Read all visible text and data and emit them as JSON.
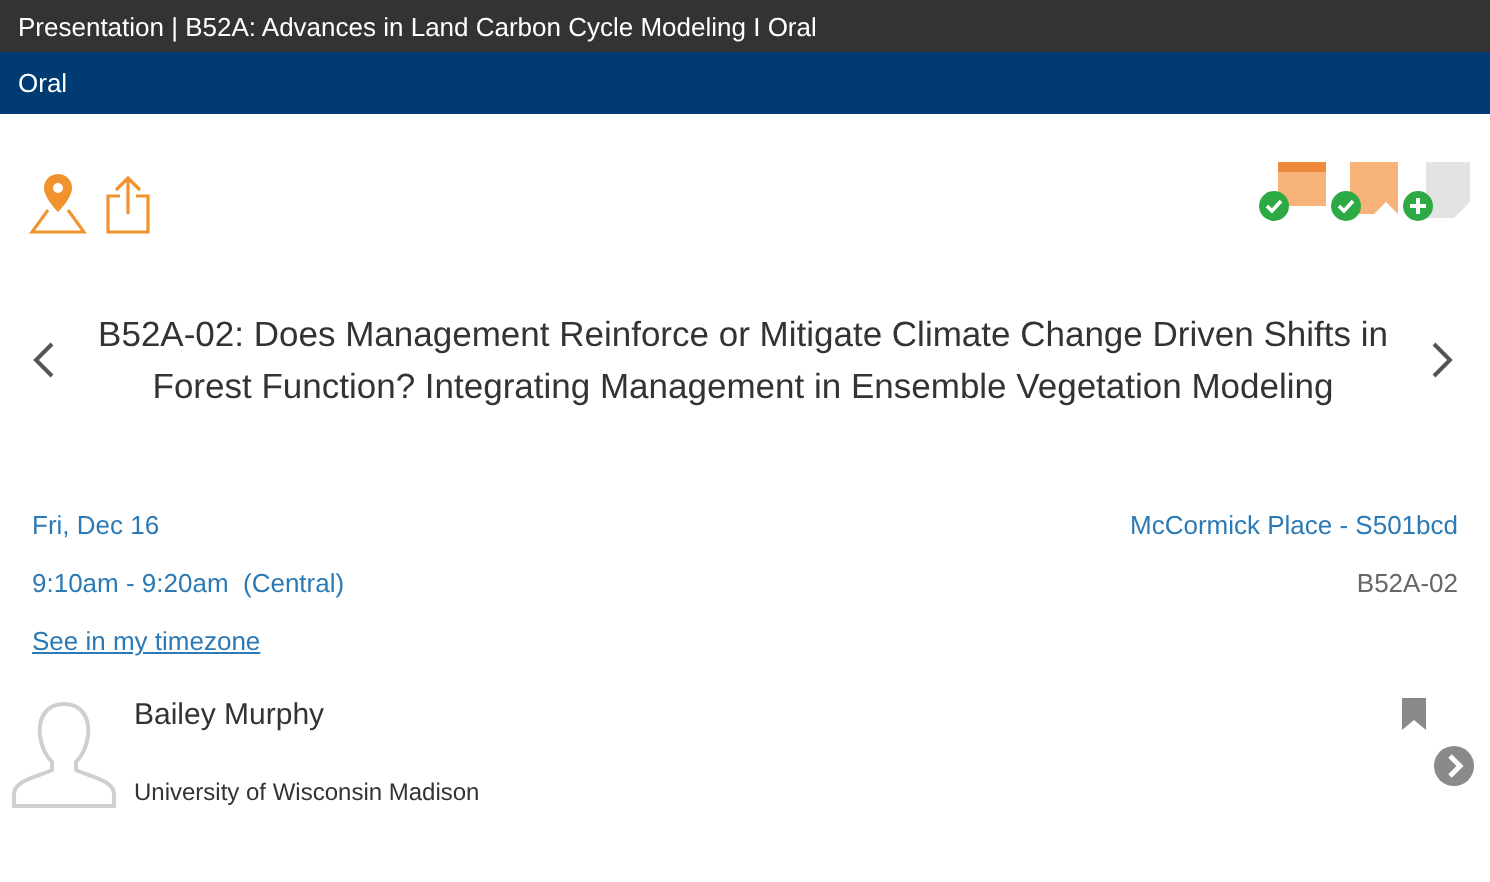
{
  "window": {
    "title": "Presentation | B52A: Advances in Land Carbon Cycle Modeling I Oral"
  },
  "subheader": "Oral",
  "status_icons": [
    {
      "kind": "calendar",
      "checked": true
    },
    {
      "kind": "bookmark",
      "checked": true
    },
    {
      "kind": "note",
      "checked": false
    }
  ],
  "title": "B52A-02: Does Management Reinforce or Mitigate Climate Change Driven Shifts in Forest Function? Integrating Management in Ensemble Vegetation Modeling",
  "date": "Fri, Dec 16",
  "time": "9:10am - 9:20am  (Central)",
  "timezone_link": "See in my timezone",
  "location": "McCormick Place - S501bcd",
  "code": "B52A-02",
  "person": {
    "name": "Bailey Murphy",
    "affiliation": "University of Wisconsin Madison"
  }
}
